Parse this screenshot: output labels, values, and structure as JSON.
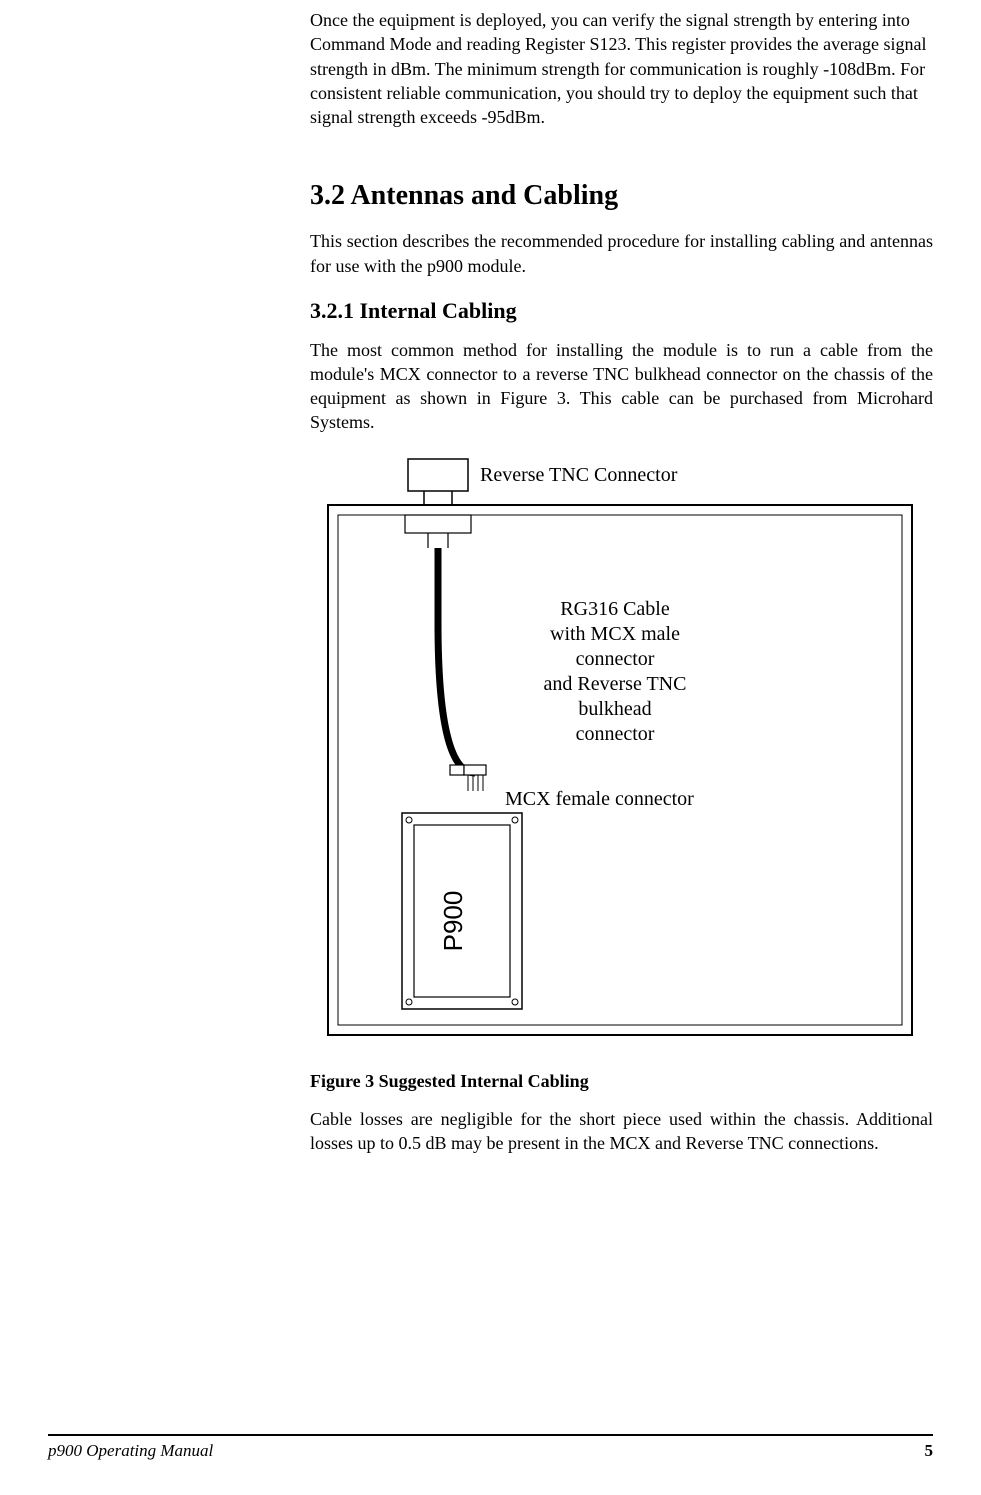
{
  "paragraphs": {
    "intro": "Once the equipment is deployed, you can verify the signal strength by entering into Command Mode and reading Register S123.  This register provides the average signal strength in dBm.  The minimum strength for communication is roughly -108dBm.  For consistent reliable communication, you should try to deploy the equipment such that signal strength exceeds -95dBm.",
    "sec32_intro": "This section describes the recommended procedure for installing cabling and antennas for use with the p900 module.",
    "sec321_body": "The most common method for installing the module is to run a cable from the module's MCX connector to a reverse TNC bulkhead connector on the chassis of the equipment as shown in Figure 3.  This cable can be purchased from Microhard Systems.",
    "after_figure": "Cable losses are negligible for the short piece used within the chassis. Additional losses up to 0.5 dB may be present in the MCX and Reverse TNC connections."
  },
  "headings": {
    "sec32": "3.2   Antennas and Cabling",
    "sec321": "3.2.1    Internal Cabling"
  },
  "figure": {
    "caption": "Figure 3 Suggested Internal Cabling",
    "labels": {
      "tnc": "Reverse TNC Connector",
      "cable_l1": "RG316 Cable",
      "cable_l2": "with MCX male",
      "cable_l3": "connector",
      "cable_l4": "and Reverse TNC",
      "cable_l5": "bulkhead",
      "cable_l6": "connector",
      "mcx": "MCX female connector",
      "module": "P900"
    }
  },
  "footer": {
    "left": "p900 Operating Manual",
    "right": "5"
  }
}
